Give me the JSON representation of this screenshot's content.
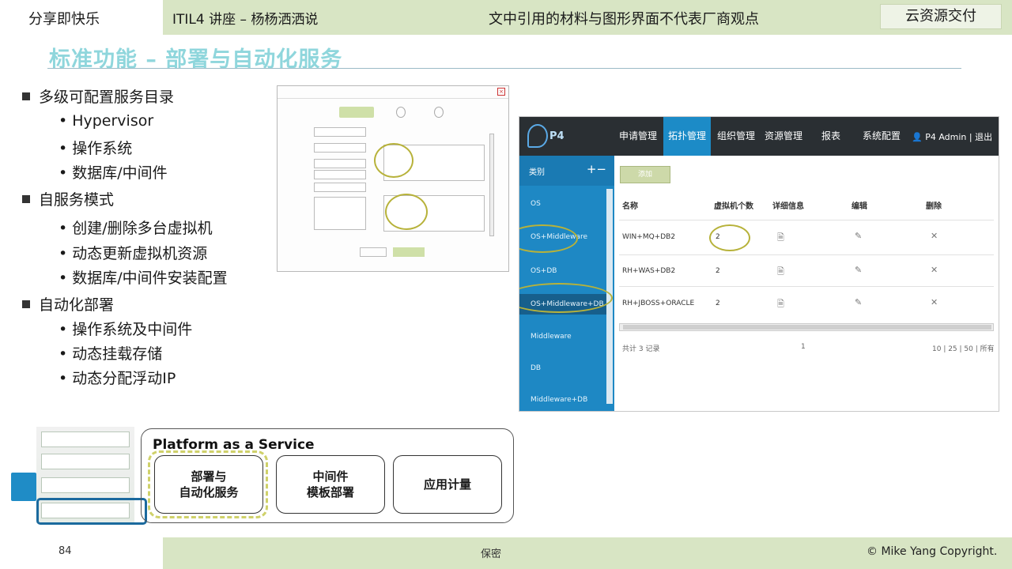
{
  "header": {
    "left": "分享即快乐",
    "course": "ITIL4 讲座 – 杨杨洒洒说",
    "disclaimer": "文中引用的材料与图形界面不代表厂商观点",
    "tag": "云资源交付"
  },
  "title": "标准功能 – 部署与自动化服务",
  "bullets": {
    "g1": "多级可配置服务目录",
    "g1_items": [
      "Hypervisor",
      "操作系统",
      "数据库/中间件"
    ],
    "g2": "自服务模式",
    "g2_items": [
      "创建/删除多台虚拟机",
      "动态更新虚拟机资源",
      "数据库/中间件安装配置"
    ],
    "g3": "自动化部署",
    "g3_items": [
      "操作系统及中间件",
      "动态挂载存储",
      "动态分配浮动IP"
    ]
  },
  "app": {
    "logo": "P4",
    "nav": [
      "申请管理",
      "拓扑管理",
      "组织管理",
      "资源管理",
      "报表",
      "系统配置"
    ],
    "user": "P4 Admin",
    "logout": "退出",
    "sidebar_head": "类别",
    "sidebar_items": [
      "OS",
      "OS+Middleware",
      "OS+DB",
      "OS+Middleware+DB",
      "Middleware",
      "DB",
      "Middleware+DB"
    ],
    "add_button": "添加",
    "columns": [
      "名称",
      "虚拟机个数",
      "详细信息",
      "编辑",
      "删除"
    ],
    "rows": [
      {
        "name": "WIN+MQ+DB2",
        "vms": "2"
      },
      {
        "name": "RH+WAS+DB2",
        "vms": "2"
      },
      {
        "name": "RH+JBOSS+ORACLE",
        "vms": "2"
      }
    ],
    "pager_total": "共计 3 记录",
    "pager_page": "1",
    "pager_sizes": "10 | 25 | 50 | 所有"
  },
  "paas": {
    "title": "Platform as a Service",
    "cards": [
      "部署与\n自动化服务",
      "中间件\n模板部署",
      "应用计量"
    ]
  },
  "footer": {
    "page": "84",
    "confidential": "保密",
    "copyright": "© Mike Yang Copyright."
  }
}
